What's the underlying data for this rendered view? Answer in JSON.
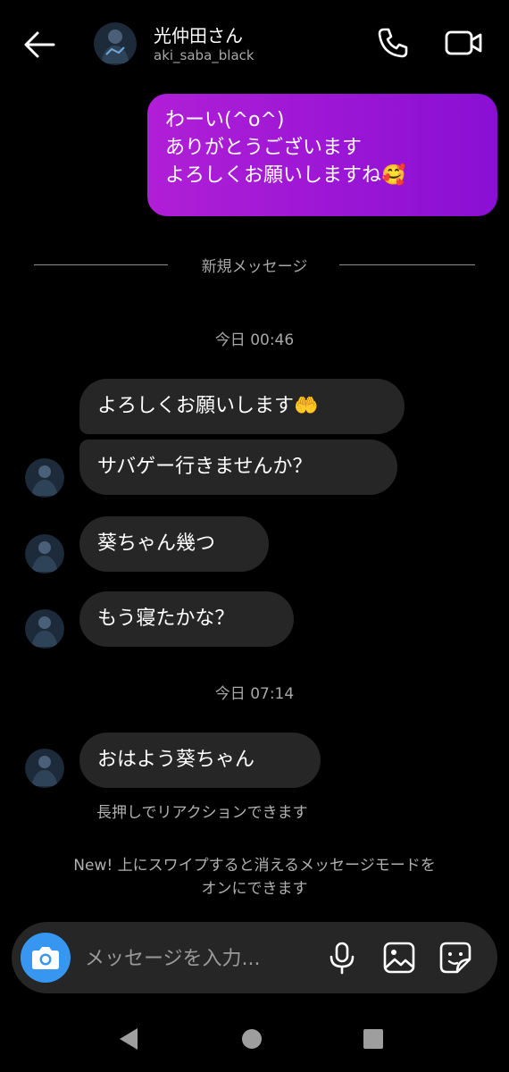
{
  "header": {
    "name": "光仲田さん",
    "username": "aki_saba_black"
  },
  "messages": {
    "outgoing": {
      "lines": [
        "わーい(^o^)",
        "ありがとうございます",
        "よろしくお願いしますね🥰"
      ]
    },
    "divider_label": "新規メッセージ",
    "timestamp_1": "今日 00:46",
    "incoming_1": "よろしくお願いします🤲",
    "incoming_2": "サバゲー行きませんか？",
    "incoming_3": "葵ちゃん幾つ",
    "incoming_4": "もう寝たかな？",
    "timestamp_2": "今日 07:14",
    "incoming_5": "おはよう葵ちゃん",
    "reaction_hint": "長押しでリアクションできます",
    "vanish_notice": [
      "New! 上にスワイプすると消えるメッセージモードを",
      "オンにできます"
    ]
  },
  "composer": {
    "placeholder": "メッセージを入力..."
  },
  "colors": {
    "outgoing_bubble": "#9c16d5",
    "incoming_bubble": "#262626",
    "camera_button": "#3797f0"
  },
  "icons": {
    "back": "arrow-left-icon",
    "call": "phone-icon",
    "video": "video-camera-icon",
    "camera": "camera-icon",
    "mic": "microphone-icon",
    "gallery": "image-icon",
    "sticker": "sticker-icon",
    "nav_back": "triangle-back-icon",
    "nav_home": "circle-home-icon",
    "nav_recents": "square-recents-icon"
  }
}
